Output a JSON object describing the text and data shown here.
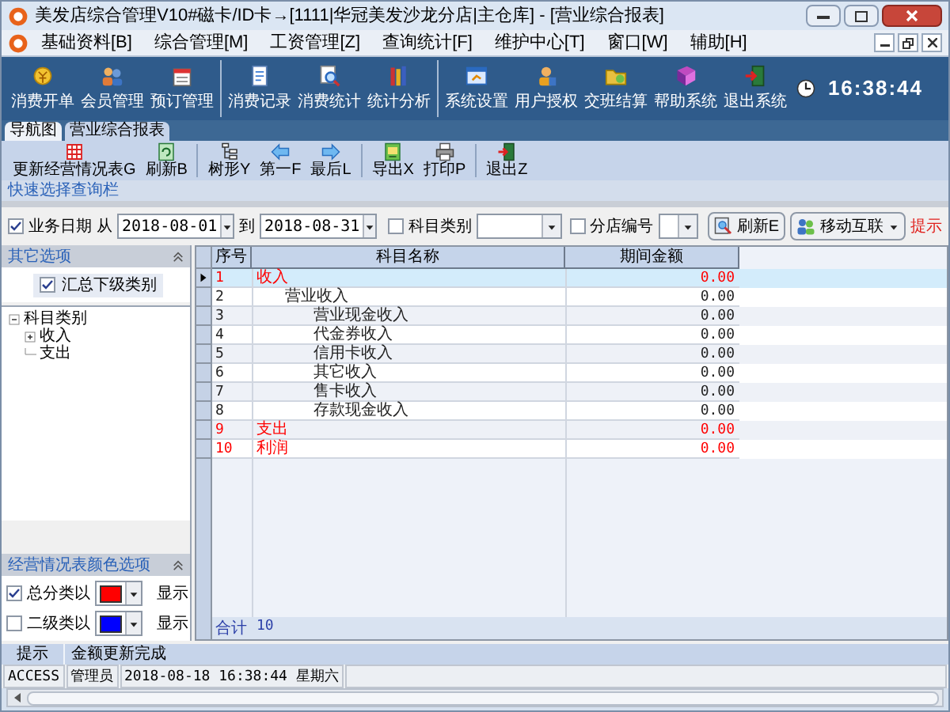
{
  "window": {
    "title": "美发店综合管理V10#磁卡/ID卡→[1111|华冠美发沙龙分店|主仓库] - [营业综合报表]"
  },
  "menu": [
    "基础资料[B]",
    "综合管理[M]",
    "工资管理[Z]",
    "查询统计[F]",
    "维护中心[T]",
    "窗口[W]",
    "辅助[H]"
  ],
  "toolbar": {
    "groups": [
      [
        "消费开单",
        "会员管理",
        "预订管理"
      ],
      [
        "消费记录",
        "消费统计",
        "统计分析"
      ],
      [
        "系统设置",
        "用户授权",
        "交班结算",
        "帮助系统",
        "退出系统"
      ]
    ],
    "clock": "16:38:44"
  },
  "tabs": [
    {
      "label": "导航图",
      "selected": false
    },
    {
      "label": "营业综合报表",
      "selected": true
    }
  ],
  "report_toolbar": [
    [
      "更新经营情况表G",
      "刷新B"
    ],
    [
      "树形Y",
      "第一F",
      "最后L"
    ],
    [
      "导出X",
      "打印P"
    ],
    [
      "退出Z"
    ]
  ],
  "quick_bar": "快速选择查询栏",
  "filter": {
    "date": {
      "label": "业务日期",
      "checked": true,
      "from_label": "从",
      "from": "2018-08-01",
      "to_label": "到",
      "to": "2018-08-31"
    },
    "category": {
      "label": "科目类别",
      "checked": false
    },
    "branch": {
      "label": "分店编号",
      "checked": false
    },
    "refresh_button": "刷新E",
    "mobile_button": "移动互联",
    "hint": "提示"
  },
  "other_options": {
    "title": "其它选项",
    "summary": {
      "label": "汇总下级类别",
      "checked": true
    }
  },
  "category_tree": [
    {
      "label": "科目类别",
      "expanded": true,
      "children": [
        {
          "label": "收入",
          "expanded": false
        },
        {
          "label": "支出"
        }
      ]
    }
  ],
  "color_options": {
    "title": "经营情况表颜色选项",
    "items": [
      {
        "label": "总分类以",
        "color": "#ff0000",
        "checked": true,
        "suffix": "显示"
      },
      {
        "label": "二级类以",
        "color": "#0000ff",
        "checked": false,
        "suffix": "显示"
      }
    ]
  },
  "table": {
    "columns": [
      "序号",
      "科目名称",
      "期间金额"
    ],
    "rows": [
      {
        "no": "1",
        "name": "收入",
        "amount": "0.00",
        "selected": true,
        "children": [
          {
            "no": "2",
            "name": "营业收入",
            "amount": "0.00",
            "selected": false,
            "children": [
              {
                "no": "3",
                "name": "营业现金收入",
                "amount": "0.00",
                "selected": false
              },
              {
                "no": "4",
                "name": "代金券收入",
                "amount": "0.00",
                "selected": false
              },
              {
                "no": "5",
                "name": "信用卡收入",
                "amount": "0.00",
                "selected": false
              },
              {
                "no": "6",
                "name": "其它收入",
                "amount": "0.00",
                "selected": false
              },
              {
                "no": "7",
                "name": "售卡收入",
                "amount": "0.00",
                "selected": false
              },
              {
                "no": "8",
                "name": "存款现金收入",
                "amount": "0.00",
                "selected": false
              }
            ]
          }
        ]
      },
      {
        "no": "9",
        "name": "支出",
        "amount": "0.00",
        "selected": false
      },
      {
        "no": "10",
        "name": "利润",
        "amount": "0.00",
        "selected": false
      }
    ],
    "footer": {
      "label": "合计",
      "count": "10"
    }
  },
  "hint_bar": {
    "label": "提示",
    "message": "金额更新完成"
  },
  "status_bar": [
    "ACCESS",
    "管理员",
    "2018-08-18 16:38:44 星期六"
  ]
}
